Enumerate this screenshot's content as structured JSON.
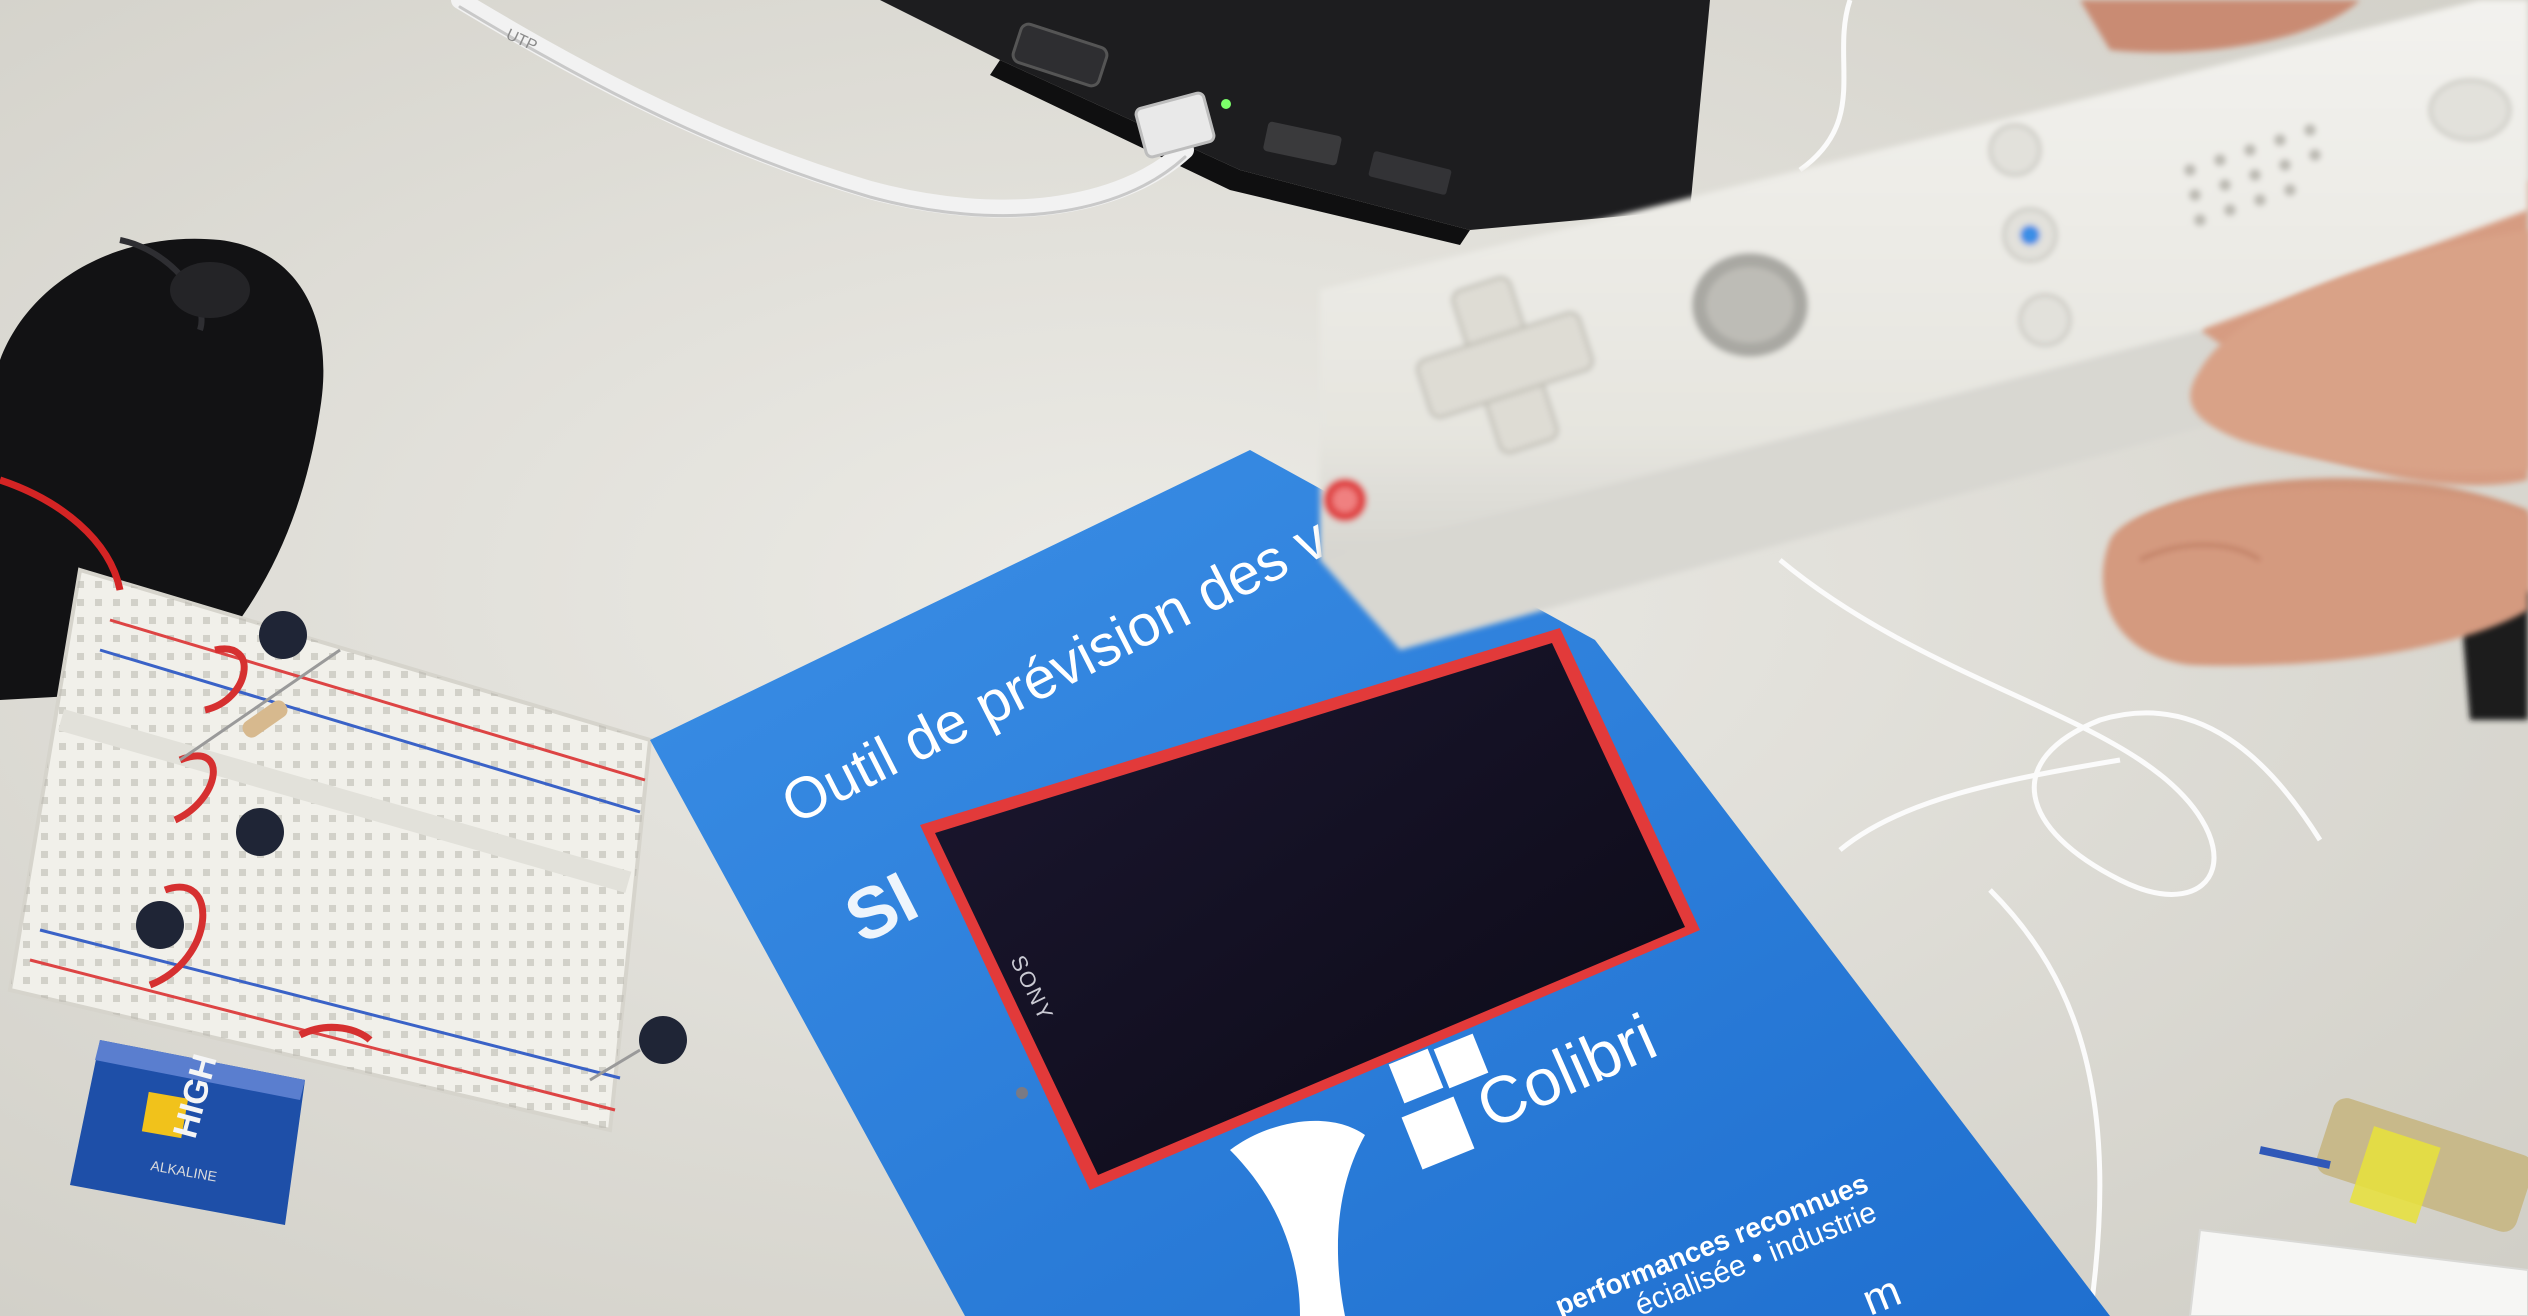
{
  "photo": {
    "flyer": {
      "headline": "Outil de prévision des v",
      "partial_word": "SI",
      "brand": "Colibri",
      "tagline_1": "performances reconnues",
      "tagline_2": "écialisée • industrie",
      "footer_fragment": "m"
    },
    "phone": {
      "brand": "SONY"
    },
    "battery": {
      "label": "HIGH",
      "sublabel": "ALKALINE"
    },
    "cable": {
      "label": "UTP"
    },
    "colors": {
      "table": "#e7e6e0",
      "flyer_blue": "#2b7fdc",
      "phone_red": "#e23a3a",
      "wiimote": "#efeeea",
      "laptop": "#1d1d1f"
    }
  }
}
